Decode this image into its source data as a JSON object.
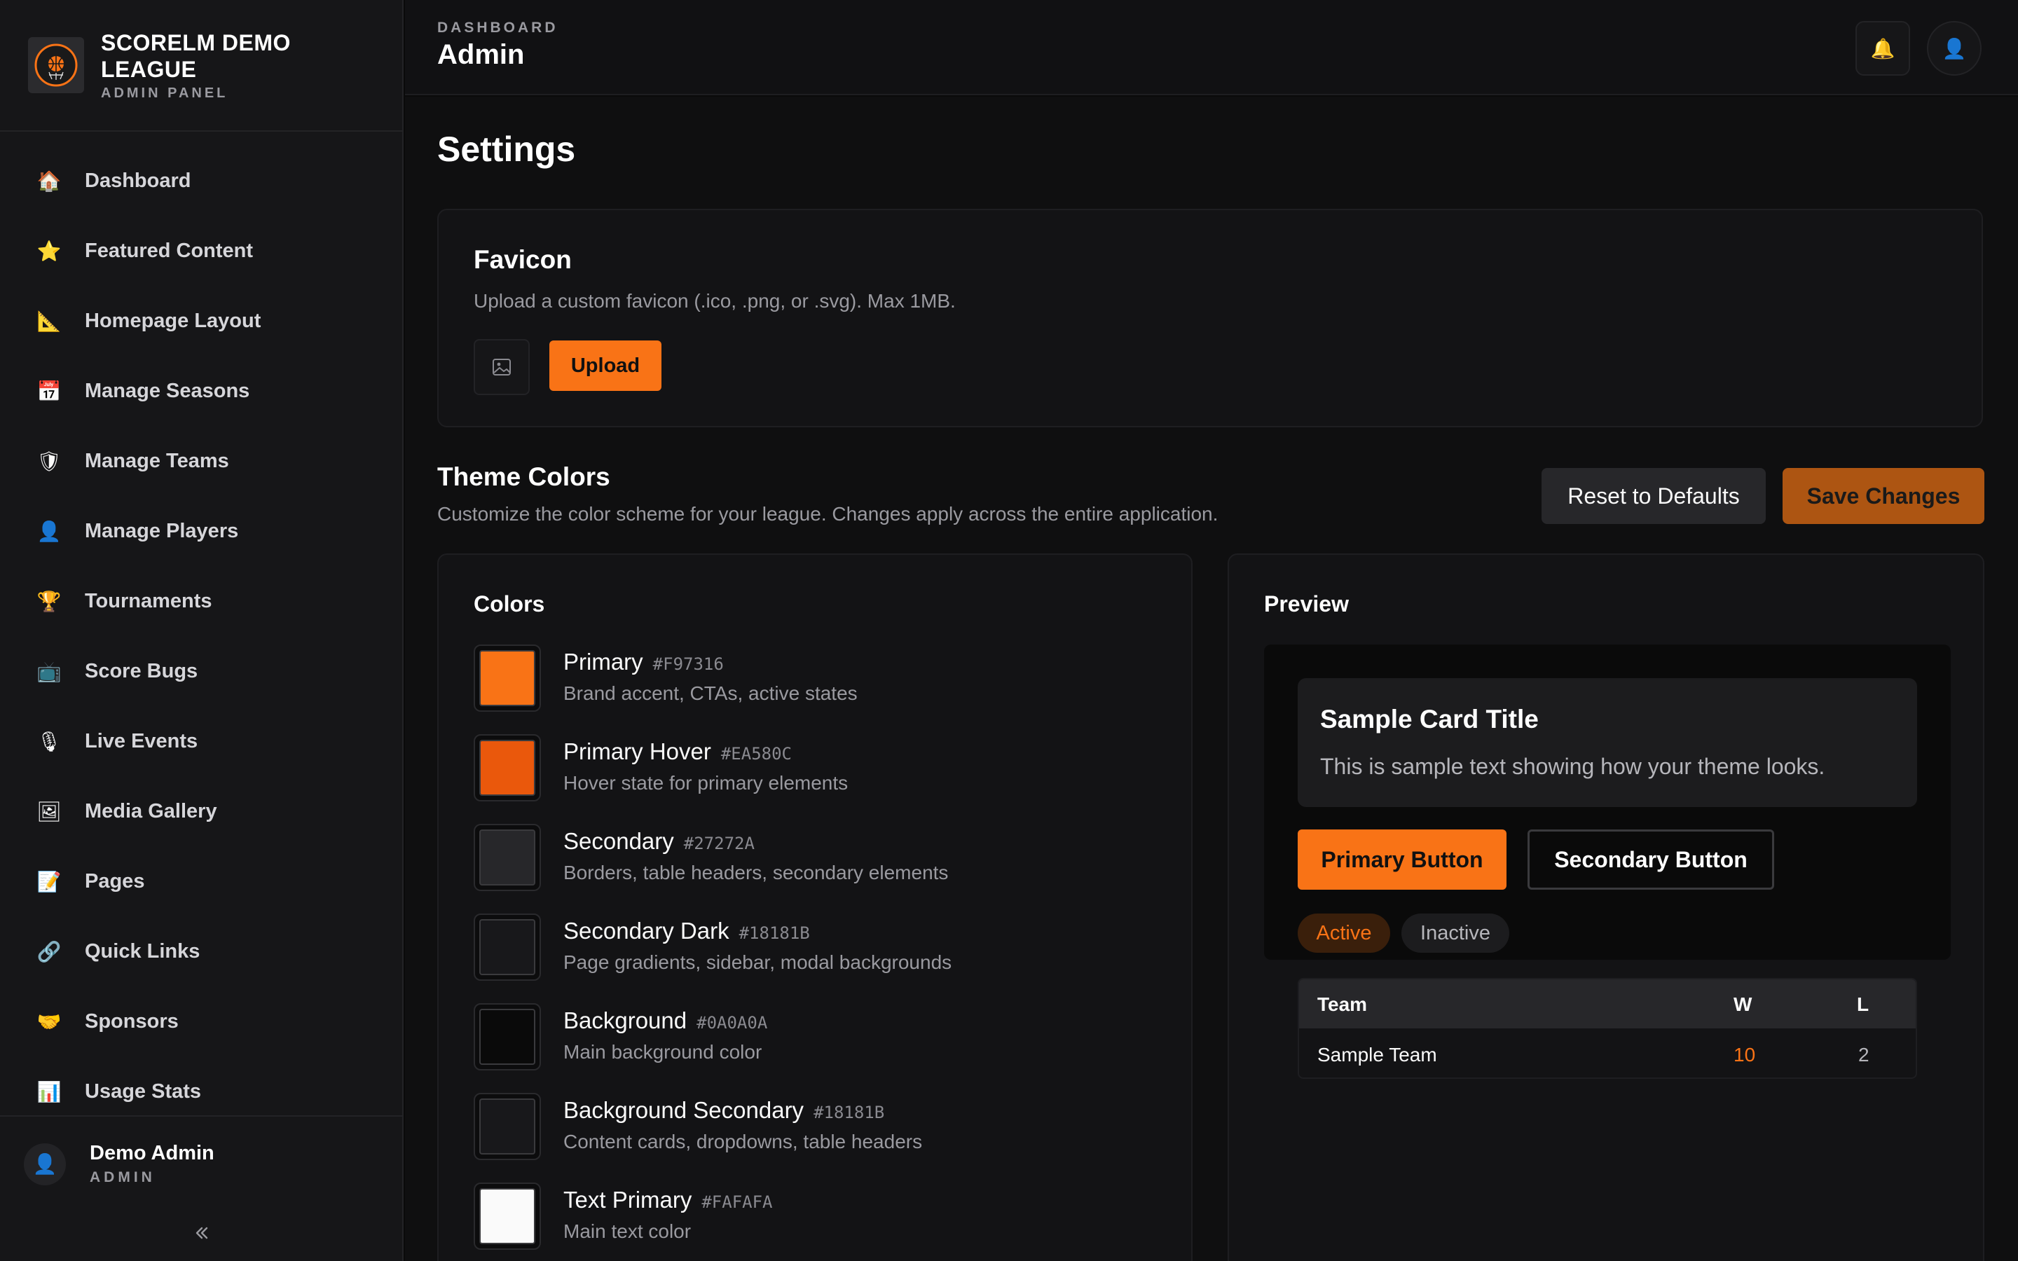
{
  "sidebar": {
    "brand_name": "SCORELM DEMO LEAGUE",
    "brand_sub": "ADMIN PANEL",
    "logo_text": "SCORELM",
    "items": [
      {
        "label": "Dashboard",
        "icon": "🏠",
        "icon_name": "house-icon"
      },
      {
        "label": "Featured Content",
        "icon": "⭐",
        "icon_name": "star-icon"
      },
      {
        "label": "Homepage Layout",
        "icon": "📐",
        "icon_name": "triangle-ruler-icon"
      },
      {
        "label": "Manage Seasons",
        "icon": "📅",
        "icon_name": "calendar-icon"
      },
      {
        "label": "Manage Teams",
        "icon": "🛡",
        "icon_name": "shield-icon"
      },
      {
        "label": "Manage Players",
        "icon": "👤",
        "icon_name": "person-icon"
      },
      {
        "label": "Tournaments",
        "icon": "🏆",
        "icon_name": "trophy-icon"
      },
      {
        "label": "Score Bugs",
        "icon": "📺",
        "icon_name": "tv-icon"
      },
      {
        "label": "Live Events",
        "icon": "🎙",
        "icon_name": "microphone-icon"
      },
      {
        "label": "Media Gallery",
        "icon": "🖼",
        "icon_name": "picture-icon"
      },
      {
        "label": "Pages",
        "icon": "📝",
        "icon_name": "memo-icon"
      },
      {
        "label": "Quick Links",
        "icon": "🔗",
        "icon_name": "link-icon"
      },
      {
        "label": "Sponsors",
        "icon": "🤝",
        "icon_name": "handshake-icon"
      },
      {
        "label": "Usage Stats",
        "icon": "📊",
        "icon_name": "bar-chart-icon"
      }
    ],
    "user": {
      "name": "Demo Admin",
      "role": "ADMIN"
    },
    "collapse_glyph": "«"
  },
  "header": {
    "breadcrumb": "DASHBOARD",
    "title": "Admin",
    "bell_glyph": "🔔",
    "user_glyph": "👤"
  },
  "main": {
    "page_title": "Settings",
    "favicon": {
      "title": "Favicon",
      "description": "Upload a custom favicon (.ico, .png, or .svg). Max 1MB.",
      "upload_label": "Upload"
    },
    "theme": {
      "title": "Theme Colors",
      "description": "Customize the color scheme for your league. Changes apply across the entire application.",
      "reset_label": "Reset to Defaults",
      "save_label": "Save Changes"
    },
    "colors_panel": {
      "title": "Colors",
      "items": [
        {
          "name": "Primary",
          "hex": "#F97316",
          "desc": "Brand accent, CTAs, active states"
        },
        {
          "name": "Primary Hover",
          "hex": "#EA580C",
          "desc": "Hover state for primary elements"
        },
        {
          "name": "Secondary",
          "hex": "#27272A",
          "desc": "Borders, table headers, secondary elements"
        },
        {
          "name": "Secondary Dark",
          "hex": "#18181B",
          "desc": "Page gradients, sidebar, modal backgrounds"
        },
        {
          "name": "Background",
          "hex": "#0A0A0A",
          "desc": "Main background color"
        },
        {
          "name": "Background Secondary",
          "hex": "#18181B",
          "desc": "Content cards, dropdowns, table headers"
        },
        {
          "name": "Text Primary",
          "hex": "#FAFAFA",
          "desc": "Main text color"
        }
      ]
    },
    "preview": {
      "title": "Preview",
      "card_title": "Sample Card Title",
      "card_text": "This is sample text showing how your theme looks.",
      "primary_button": "Primary Button",
      "secondary_button": "Secondary Button",
      "pill_active": "Active",
      "pill_inactive": "Inactive",
      "table": {
        "headers": [
          "Team",
          "W",
          "L"
        ],
        "row": [
          "Sample Team",
          "10",
          "2"
        ]
      }
    }
  }
}
